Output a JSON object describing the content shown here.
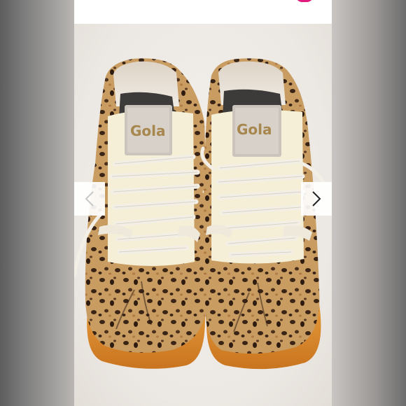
{
  "listing": {
    "photo": {
      "brand_label_left": "Gola",
      "brand_label_right": "Gola",
      "icon": "leopard-print-sneakers-image"
    },
    "nav": {
      "prev_icon": "chevron-left-icon",
      "next_icon": "chevron-right-icon"
    }
  },
  "colors": {
    "accent": "#e21a7c",
    "card_bg": "#f3f1ee",
    "sole": "#d98a2e",
    "suede_tan": "#c49659",
    "brand_gold": "#a8874e"
  }
}
